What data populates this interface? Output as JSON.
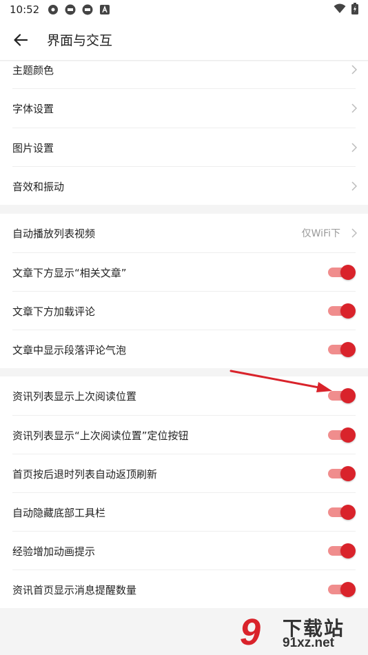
{
  "status_bar": {
    "time": "10:52",
    "icons": [
      "settings-gear-icon",
      "app-badge-icon",
      "app-badge-icon",
      "a-badge-icon"
    ],
    "right_icons": [
      "wifi-icon",
      "battery-icon"
    ]
  },
  "header": {
    "back_icon": "arrow-left-icon",
    "title": "界面与交互"
  },
  "group1": [
    {
      "label": "主题颜色"
    },
    {
      "label": "字体设置"
    },
    {
      "label": "图片设置"
    },
    {
      "label": "音效和振动"
    }
  ],
  "group2": {
    "autoplay": {
      "label": "自动播放列表视频",
      "value": "仅WiFi下"
    },
    "toggles": [
      {
        "label": "文章下方显示“相关文章”",
        "on": true
      },
      {
        "label": "文章下方加载评论",
        "on": true
      },
      {
        "label": "文章中显示段落评论气泡",
        "on": true
      }
    ]
  },
  "group3": [
    {
      "label": "资讯列表显示上次阅读位置",
      "on": true
    },
    {
      "label": "资讯列表显示“上次阅读位置”定位按钮",
      "on": true
    },
    {
      "label": "首页按后退时列表自动返顶刷新",
      "on": true
    },
    {
      "label": "自动隐藏底部工具栏",
      "on": true
    },
    {
      "label": "经验增加动画提示",
      "on": true
    },
    {
      "label": "资讯首页显示消息提醒数量",
      "on": true
    }
  ],
  "colors": {
    "accent": "#d9232b",
    "track": "#f08d8d",
    "annotation_arrow": "#d9232b"
  },
  "watermark": {
    "logo": "9",
    "title": "下载站",
    "url": "91xz.net"
  }
}
